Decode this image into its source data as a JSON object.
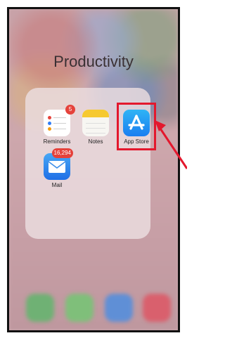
{
  "folder": {
    "title": "Productivity",
    "apps": [
      {
        "label": "Reminders",
        "badge": "5"
      },
      {
        "label": "Notes",
        "badge": ""
      },
      {
        "label": "App Store",
        "badge": ""
      },
      {
        "label": "Mail",
        "badge": "16,294"
      }
    ]
  },
  "colors": {
    "highlight": "#e3182d",
    "badge": "#e5423b"
  }
}
